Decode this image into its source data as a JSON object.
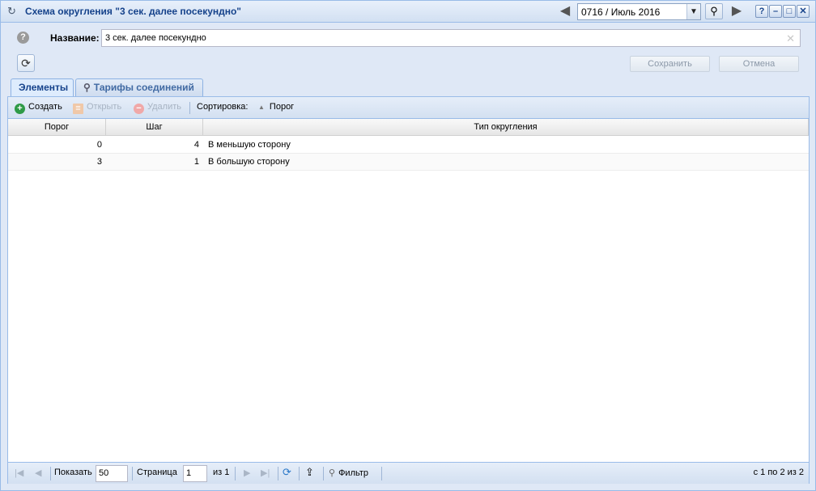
{
  "window": {
    "title": "Схема округления \"3 сек. далее посекундно\"",
    "period": "0716 / Июль 2016",
    "controls": {
      "help": "?",
      "minimize": "–",
      "maximize": "□",
      "close": "✕"
    }
  },
  "form": {
    "name_label": "Название:",
    "name_value": "3 сек. далее посекундно",
    "save_label": "Сохранить",
    "cancel_label": "Отмена"
  },
  "tabs": [
    {
      "label": "Элементы",
      "active": true
    },
    {
      "label": "Тарифы соединений",
      "active": false
    }
  ],
  "toolbar": {
    "create": "Создать",
    "open": "Открыть",
    "delete": "Удалить",
    "sort_label": "Сортировка:",
    "sort_field": "Порог"
  },
  "grid": {
    "columns": [
      "Порог",
      "Шаг",
      "Тип округления"
    ],
    "rows": [
      {
        "threshold": "0",
        "step": "4",
        "type": "В меньшую сторону"
      },
      {
        "threshold": "3",
        "step": "1",
        "type": "В большую сторону"
      }
    ]
  },
  "pager": {
    "show_label": "Показать",
    "page_size": "50",
    "page_label": "Страница",
    "page_value": "1",
    "of_label": "из 1",
    "filter_label": "Фильтр",
    "summary": "с 1 по 2 из 2"
  },
  "colors": {
    "accent": "#15428b",
    "border": "#99bbe8",
    "background": "#dfe8f6"
  }
}
